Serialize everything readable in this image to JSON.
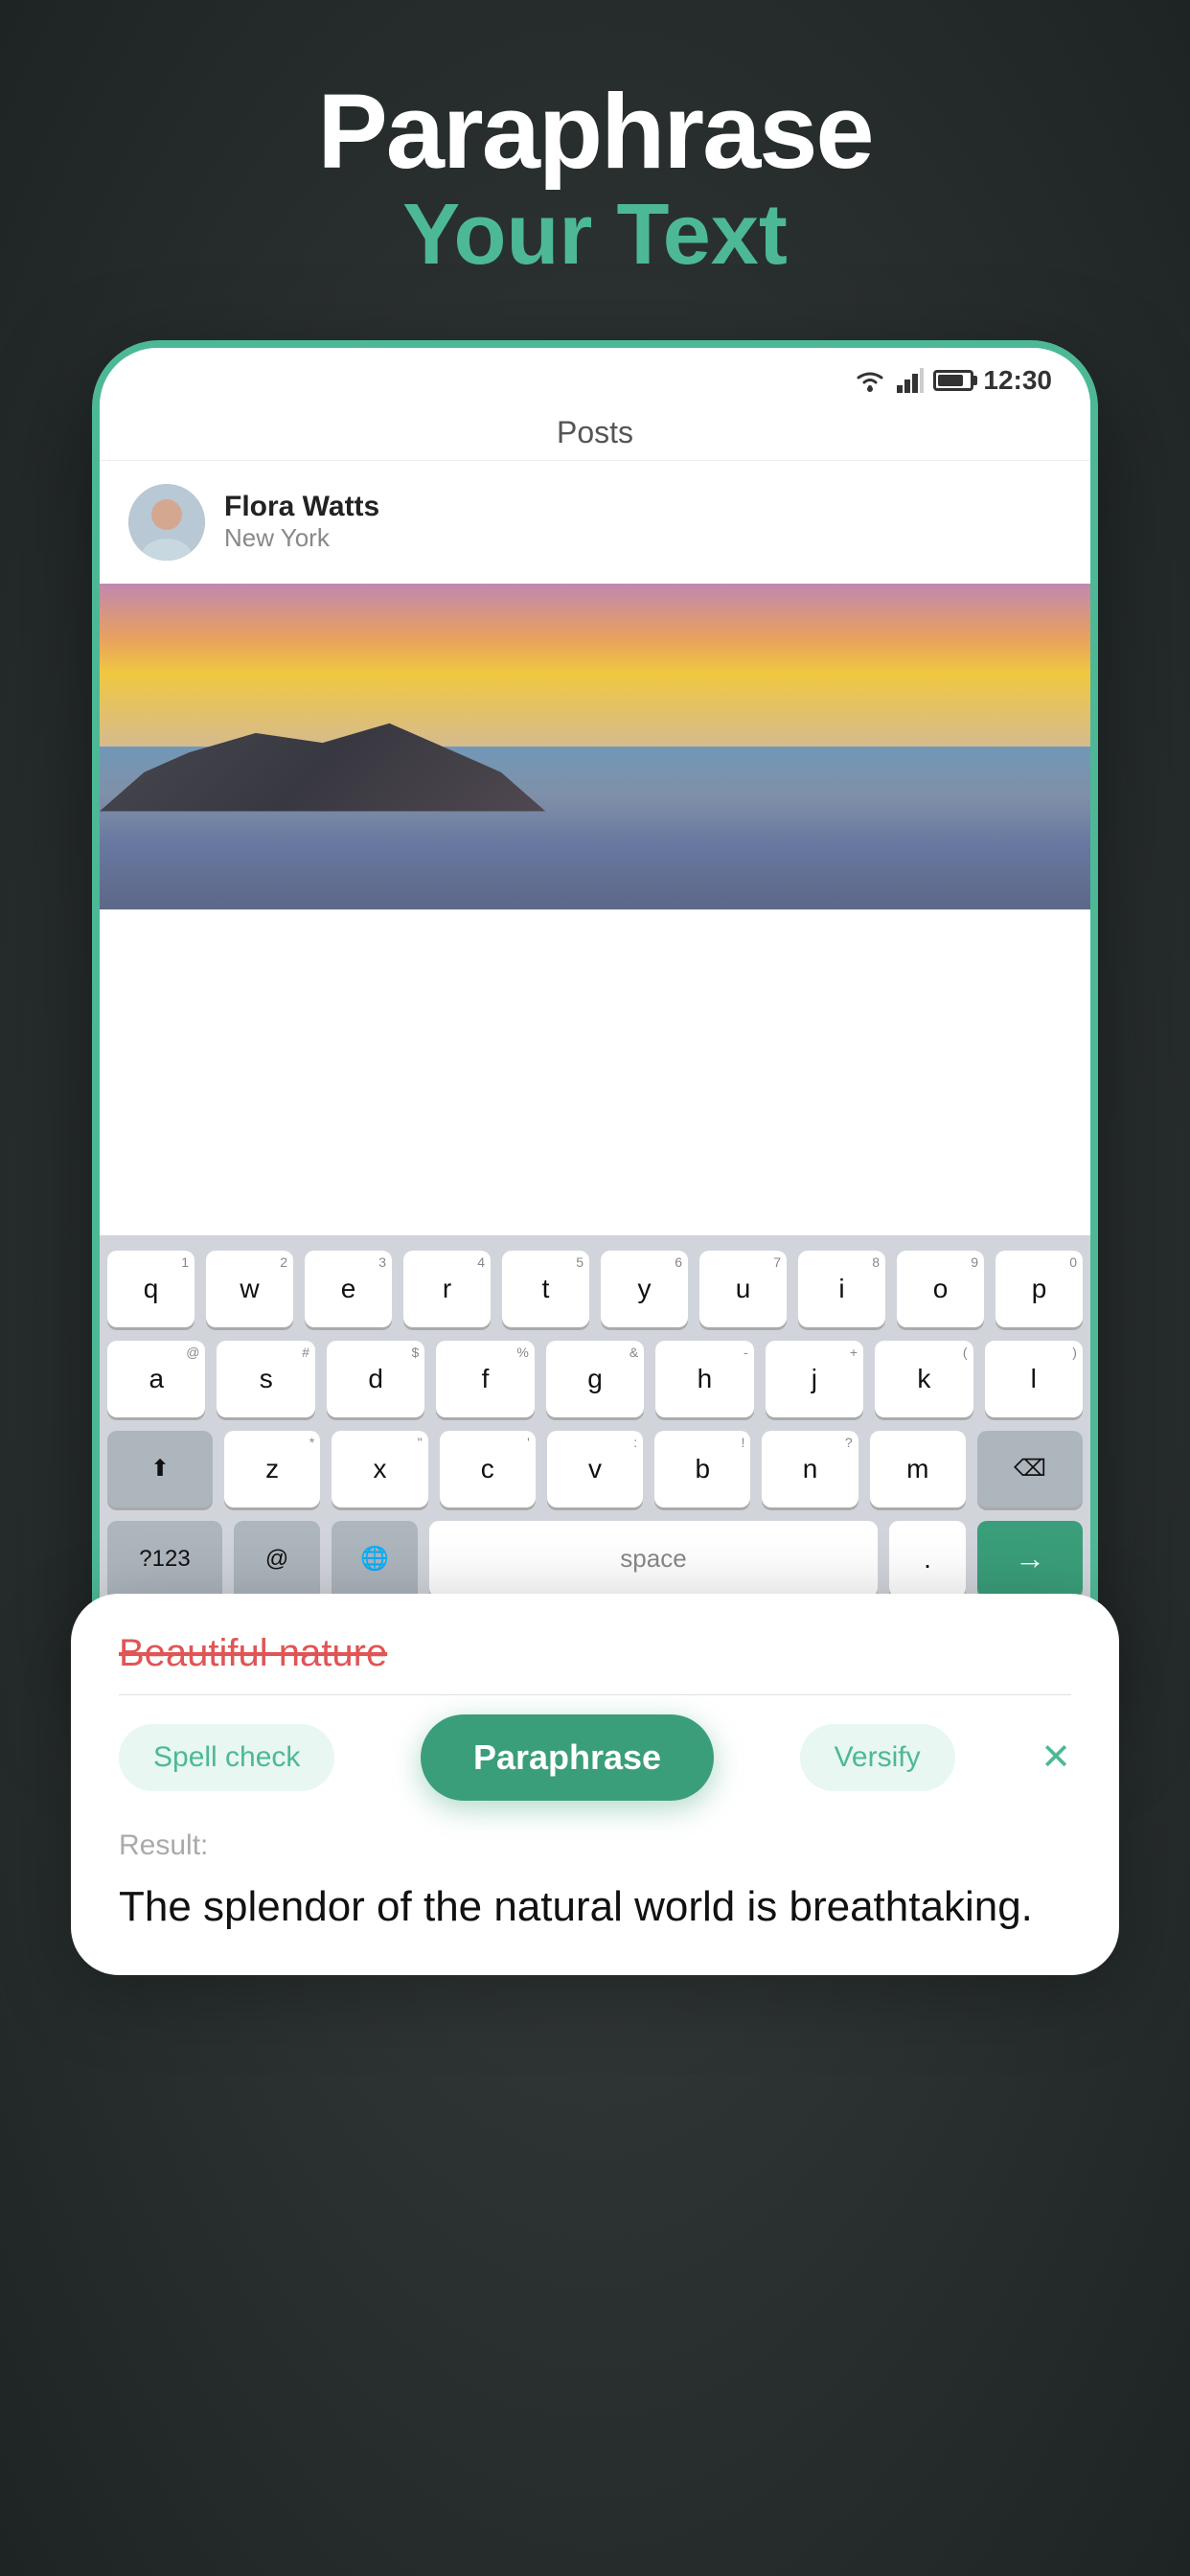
{
  "headline": {
    "line1": "Paraphrase",
    "line2": "Your Text"
  },
  "status_bar": {
    "time": "12:30"
  },
  "posts": {
    "header": "Posts"
  },
  "profile": {
    "name": "Flora Watts",
    "location": "New York"
  },
  "paraphrase_popup": {
    "strikethrough": "Beautiful nature",
    "btn_spell_check": "Spell check",
    "btn_paraphrase": "Paraphrase",
    "btn_versify": "Versify",
    "result_label": "Result:",
    "result_text": "The splendor of the natural world is breathtaking."
  },
  "keyboard": {
    "row1": [
      "q",
      "w",
      "e",
      "r",
      "t",
      "y",
      "u",
      "i",
      "o",
      "p"
    ],
    "row1_super": [
      "1",
      "2",
      "3",
      "4",
      "5",
      "6",
      "7",
      "8",
      "9",
      "0"
    ],
    "row2": [
      "a",
      "s",
      "d",
      "f",
      "g",
      "h",
      "j",
      "k",
      "l"
    ],
    "row2_super": [
      "@",
      "#",
      "$",
      "%",
      "&",
      "-",
      "+",
      "(",
      ")",
      "`"
    ],
    "row3": [
      "z",
      "x",
      "c",
      "v",
      "b",
      "n",
      "m"
    ],
    "row3_super": [
      "*",
      "\"",
      "'",
      ":",
      "!",
      "?",
      ""
    ],
    "btn_num": "?123",
    "btn_at": "@",
    "btn_globe": "🌐",
    "btn_space": "space",
    "btn_period": ".",
    "btn_enter": "→"
  },
  "nav": {
    "back": "|||",
    "home": "○",
    "recent": "∨",
    "keyboard": "⌨"
  },
  "colors": {
    "green_accent": "#3a9e7a",
    "green_light": "#4db896",
    "strikethrough_red": "#e05555"
  }
}
